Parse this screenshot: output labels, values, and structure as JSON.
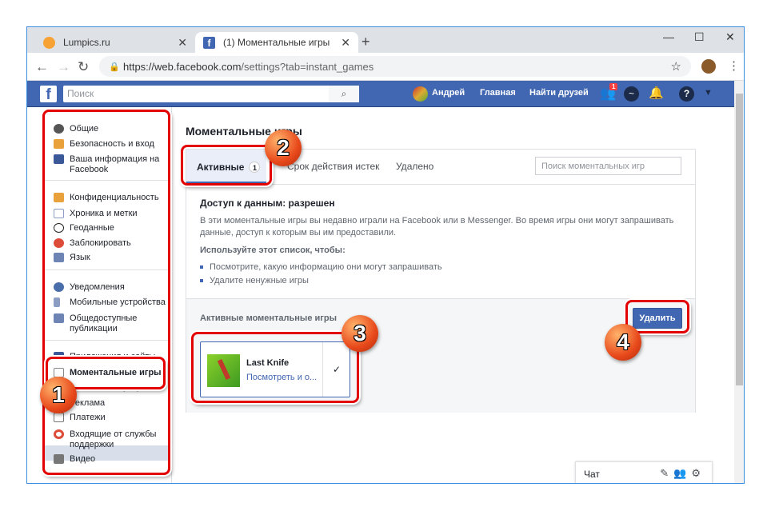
{
  "browser": {
    "tabs": [
      {
        "title": "Lumpics.ru",
        "active": false
      },
      {
        "title": "(1) Моментальные игры",
        "active": true
      }
    ],
    "url_host": "https://web.facebook.com",
    "url_path": "/settings?tab=instant_games"
  },
  "fb_header": {
    "search_placeholder": "Поиск",
    "user": "Андрей",
    "home": "Главная",
    "find_friends": "Найти друзей",
    "friend_requests_badge": "1",
    "brand_color": "#4267b2"
  },
  "sidebar": {
    "items": [
      {
        "label": "Общие",
        "icon": "gears-icon"
      },
      {
        "label": "Безопасность и вход",
        "icon": "shield-icon"
      },
      {
        "label": "Ваша информация на Facebook",
        "icon": "facebook-icon"
      },
      {
        "label": "Конфиденциальность",
        "icon": "lock-icon"
      },
      {
        "label": "Хроника и метки",
        "icon": "timeline-icon"
      },
      {
        "label": "Геоданные",
        "icon": "location-icon"
      },
      {
        "label": "Заблокировать",
        "icon": "block-icon"
      },
      {
        "label": "Язык",
        "icon": "language-icon"
      },
      {
        "label": "Уведомления",
        "icon": "globe-icon"
      },
      {
        "label": "Мобильные устройства",
        "icon": "mobile-icon"
      },
      {
        "label": "Общедоступные публикации",
        "icon": "rss-icon"
      },
      {
        "label": "Приложения и сайты",
        "icon": "apps-icon"
      },
      {
        "label": "Моментальные игры",
        "icon": "gamepad-icon",
        "selected": true
      },
      {
        "label": "Бизнес-интеграции",
        "icon": "business-icon"
      },
      {
        "label": "Реклама",
        "icon": "ads-icon"
      },
      {
        "label": "Платежи",
        "icon": "card-icon"
      },
      {
        "label": "Входящие от службы поддержки",
        "icon": "lifebuoy-icon"
      },
      {
        "label": "Видео",
        "icon": "film-icon"
      }
    ]
  },
  "main": {
    "title": "Моментальные игры",
    "tabs": [
      {
        "label": "Активные",
        "count": "1"
      },
      {
        "label": "Срок действия истек"
      },
      {
        "label": "Удалено"
      }
    ],
    "search_placeholder": "Поиск моментальных игр",
    "info_title": "Доступ к данным: разрешен",
    "info_text": "В эти моментальные игры вы недавно играли на Facebook или в Messenger. Во время игры они могут запрашивать данные, доступ к которым вы им предоставили.",
    "use_title": "Используйте этот список, чтобы:",
    "bullets": [
      "Посмотрите, какую информацию они могут запрашивать",
      "Удалите ненужные игры"
    ],
    "active_label": "Активные моментальные игры",
    "delete_button": "Удалить",
    "game": {
      "name": "Last Knife",
      "link": "Посмотреть и о...",
      "checked": true
    }
  },
  "chat": {
    "label": "Чат"
  },
  "callouts": [
    "1",
    "2",
    "3",
    "4"
  ]
}
